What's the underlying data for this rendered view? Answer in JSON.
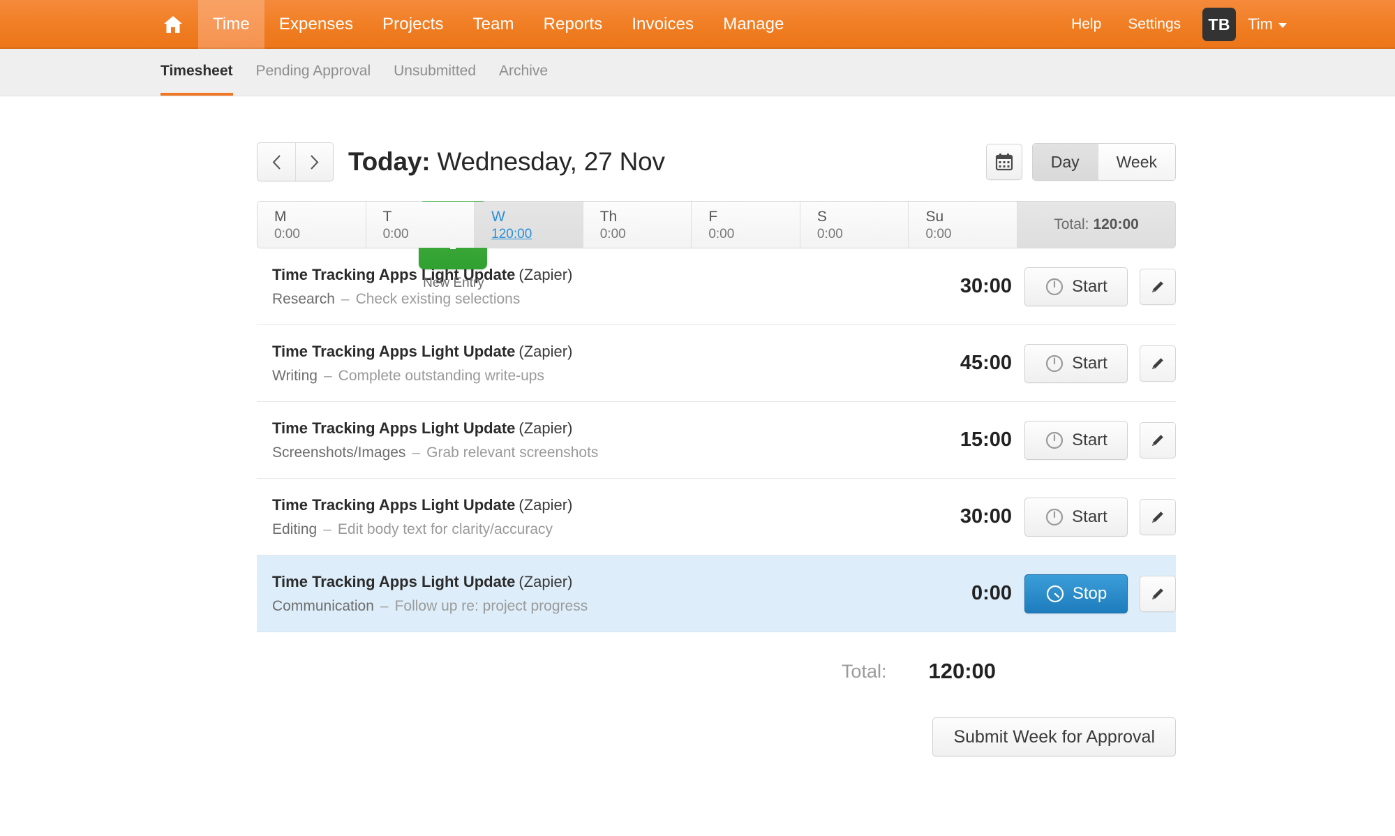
{
  "topnav": {
    "home_icon": "home-icon",
    "items": [
      {
        "label": "Time",
        "active": true
      },
      {
        "label": "Expenses",
        "active": false
      },
      {
        "label": "Projects",
        "active": false
      },
      {
        "label": "Team",
        "active": false
      },
      {
        "label": "Reports",
        "active": false
      },
      {
        "label": "Invoices",
        "active": false
      },
      {
        "label": "Manage",
        "active": false
      }
    ],
    "help": "Help",
    "settings": "Settings",
    "avatar_initials": "TB",
    "user_name": "Tim",
    "brand_color": "#ef7622"
  },
  "subnav": {
    "items": [
      {
        "label": "Timesheet",
        "active": true
      },
      {
        "label": "Pending Approval",
        "active": false
      },
      {
        "label": "Unsubmitted",
        "active": false
      },
      {
        "label": "Archive",
        "active": false
      }
    ],
    "active_underline_color": "#ef7622"
  },
  "header": {
    "prev_icon": "chevron-left-icon",
    "next_icon": "chevron-right-icon",
    "today_label": "Today:",
    "date_label": "Wednesday, 27 Nov",
    "calendar_icon": "calendar-icon",
    "view_options": [
      {
        "label": "Day",
        "selected": true
      },
      {
        "label": "Week",
        "selected": false
      }
    ]
  },
  "new_entry": {
    "icon": "plus-icon",
    "label": "New Entry",
    "color": "#34a334"
  },
  "week_strip": {
    "days": [
      {
        "letter": "M",
        "hours": "0:00",
        "active": false
      },
      {
        "letter": "T",
        "hours": "0:00",
        "active": false
      },
      {
        "letter": "W",
        "hours": "120:00",
        "active": true
      },
      {
        "letter": "Th",
        "hours": "0:00",
        "active": false
      },
      {
        "letter": "F",
        "hours": "0:00",
        "active": false
      },
      {
        "letter": "S",
        "hours": "0:00",
        "active": false
      },
      {
        "letter": "Su",
        "hours": "0:00",
        "active": false
      }
    ],
    "total_label": "Total:",
    "total_value": "120:00",
    "active_color": "#2b8fdb"
  },
  "entries": [
    {
      "project": "Time Tracking Apps Light Update",
      "client": "(Zapier)",
      "task": "Research",
      "separator": "–",
      "note": "Check existing selections",
      "duration": "30:00",
      "timer_label": "Start",
      "timer_icon": "timer-icon",
      "running": false,
      "edit_icon": "pencil-icon"
    },
    {
      "project": "Time Tracking Apps Light Update",
      "client": "(Zapier)",
      "task": "Writing",
      "separator": "–",
      "note": "Complete outstanding write-ups",
      "duration": "45:00",
      "timer_label": "Start",
      "timer_icon": "timer-icon",
      "running": false,
      "edit_icon": "pencil-icon"
    },
    {
      "project": "Time Tracking Apps Light Update",
      "client": "(Zapier)",
      "task": "Screenshots/Images",
      "separator": "–",
      "note": "Grab relevant screenshots",
      "duration": "15:00",
      "timer_label": "Start",
      "timer_icon": "timer-icon",
      "running": false,
      "edit_icon": "pencil-icon"
    },
    {
      "project": "Time Tracking Apps Light Update",
      "client": "(Zapier)",
      "task": "Editing",
      "separator": "–",
      "note": "Edit body text for clarity/accuracy",
      "duration": "30:00",
      "timer_label": "Start",
      "timer_icon": "timer-icon",
      "running": false,
      "edit_icon": "pencil-icon"
    },
    {
      "project": "Time Tracking Apps Light Update",
      "client": "(Zapier)",
      "task": "Communication",
      "separator": "–",
      "note": "Follow up re: project progress",
      "duration": "0:00",
      "timer_label": "Stop",
      "timer_icon": "timer-running-icon",
      "running": true,
      "edit_icon": "pencil-icon"
    }
  ],
  "footer": {
    "total_label": "Total:",
    "total_value": "120:00",
    "submit_label": "Submit Week for Approval"
  }
}
